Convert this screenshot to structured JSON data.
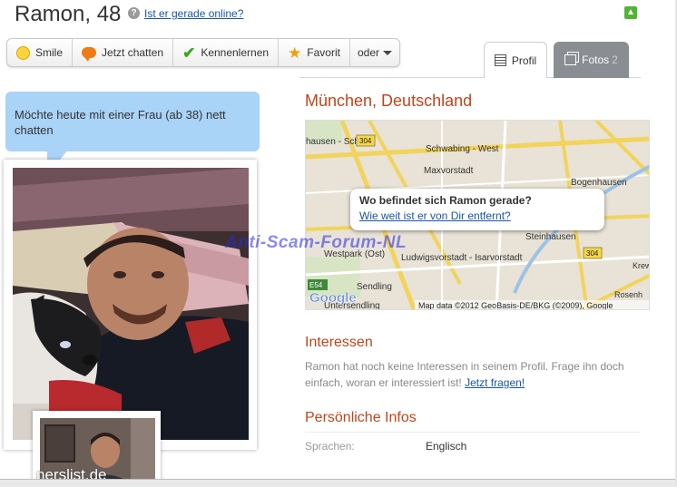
{
  "profile": {
    "name_age": "Ramon, 48",
    "online_link": "Ist er gerade online?"
  },
  "actions": [
    {
      "label": "Smile",
      "icon": "smile-icon"
    },
    {
      "label": "Jetzt chatten",
      "icon": "chat-bubble-icon"
    },
    {
      "label": "Kennenlernen",
      "icon": "checkmark-icon"
    },
    {
      "label": "Favorit",
      "icon": "star-icon"
    },
    {
      "label": "oder",
      "icon": "chevron-down-icon"
    }
  ],
  "tabs": {
    "profil": "Profil",
    "fotos": "Fotos",
    "fotos_count": "2"
  },
  "status_message": "Möchte heute mit einer Frau (ab 38) nett chatten",
  "location": {
    "title": "München, Deutschland",
    "popup_question": "Wo befindet sich Ramon gerade?",
    "popup_link": "Wie weit ist er von Dir entfernt?",
    "map_attribution": "Map data ©2012 GeoBasis-DE/BKG (©2009), Google",
    "map_logo": "Google",
    "map_labels": [
      "Schwabing - West",
      "hausen - Sch",
      "Maxvorstadt",
      "Bogenhausen",
      "Steinhausen",
      "Westpark (Ost)",
      "Ludwigsvorstadt - Isarvorstadt",
      "Sendling",
      "Untersendling",
      "304",
      "304",
      "E54",
      "Krew",
      "Rosenh"
    ]
  },
  "interests": {
    "heading": "Interessen",
    "text": "Ramon hat noch keine Interessen in seinem Profil. Frage ihn doch einfach, woran er interessiert ist!",
    "link": "Jetzt fragen!"
  },
  "personal": {
    "heading": "Persönliche Infos",
    "language_label": "Sprachen:",
    "language_value": "Englisch"
  },
  "watermarks": {
    "scam": "Anti-Scam-Forum-NL",
    "url": "nerslist.de"
  },
  "colors": {
    "heading": "#c0451b",
    "link": "#1a55a8",
    "bubble": "#a9d3f7",
    "tab_inactive": "#8a8d92"
  }
}
